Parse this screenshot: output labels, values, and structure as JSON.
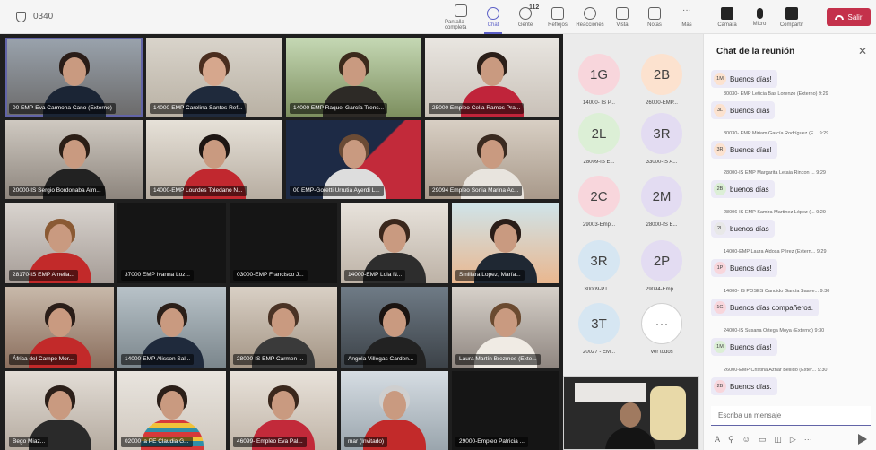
{
  "topbar": {
    "timer": "0340",
    "tools": [
      {
        "label": "Pantalla completa",
        "name": "fullscreen-button"
      },
      {
        "label": "Chat",
        "name": "chat-button",
        "active": true
      },
      {
        "label": "Gente",
        "name": "people-button",
        "count": "112"
      },
      {
        "label": "Reflejos",
        "name": "raise-hand-button"
      },
      {
        "label": "Reacciones",
        "name": "reactions-button"
      },
      {
        "label": "Vista",
        "name": "view-button"
      },
      {
        "label": "Notas",
        "name": "notes-button"
      },
      {
        "label": "Más",
        "name": "more-button"
      }
    ],
    "media": [
      {
        "label": "Cámara",
        "name": "camera-button"
      },
      {
        "label": "Micro",
        "name": "mic-button"
      },
      {
        "label": "Compartir",
        "name": "share-button"
      }
    ],
    "leave_label": "Salir"
  },
  "videos": [
    {
      "name": "00 EMP-Eva Carmona Cano (Externo)"
    },
    {
      "name": "14000-EMP Carolina Santos Ref..."
    },
    {
      "name": "14000 EMP Raquel García Trens..."
    },
    {
      "name": "25000 Empleo Celia Ramos Pra..."
    },
    {
      "name": "20000-IS Sergio Bordonaba Alm..."
    },
    {
      "name": "14000-EMP Lourdes Toledano N..."
    },
    {
      "name": "00 EMP-Goretti Urrutia Ayerdi L..."
    },
    {
      "name": "29094 Empleo Sonia Marina Ac..."
    },
    {
      "name": "28170-IS EMP Amelia..."
    },
    {
      "name": "37000 EMP Ivanna Loz..."
    },
    {
      "name": "03000-EMP Francisco J..."
    },
    {
      "name": "14000-EMP Lola N..."
    },
    {
      "name": "Smillara Lopez, María..."
    },
    {
      "name": "África del Campo Mor..."
    },
    {
      "name": "14000-EMP Alisson Sal..."
    },
    {
      "name": "28000-IS EMP Carmen ..."
    },
    {
      "name": "Angela Villegas Carden..."
    },
    {
      "name": "Laura Martín Brezmes (Exte..."
    },
    {
      "name": "Bego Miaz..."
    },
    {
      "name": "02000 la PE Claudia G..."
    },
    {
      "name": "46099- Empleo Eva Pal..."
    },
    {
      "name": "mar (Invitado)"
    },
    {
      "name": "29000-Empleo Patricia ..."
    }
  ],
  "avatars": [
    {
      "initials": "1G",
      "label": "14000- IS P...",
      "color": "#f8d6dc"
    },
    {
      "initials": "2B",
      "label": "26000-EMP...",
      "color": "#fce2cf"
    },
    {
      "initials": "2L",
      "label": "28009-IS E...",
      "color": "#dcefd6"
    },
    {
      "initials": "3R",
      "label": "33000-IS A...",
      "color": "#e3dcf2"
    },
    {
      "initials": "2C",
      "label": "29003-Emp...",
      "color": "#f8d6dc"
    },
    {
      "initials": "2M",
      "label": "28000-IS E...",
      "color": "#e3dcf2"
    },
    {
      "initials": "3R",
      "label": "30009-PT ...",
      "color": "#d6e6f2"
    },
    {
      "initials": "2P",
      "label": "29094-Emp...",
      "color": "#e3dcf2"
    },
    {
      "initials": "3T",
      "label": "20027 - EM...",
      "color": "#d6e6f2"
    },
    {
      "initials": "···",
      "label": "Ver todos",
      "color": "#ffffff"
    }
  ],
  "chat": {
    "title": "Chat de la reunión",
    "messages": [
      {
        "meta": "",
        "initials": "1M",
        "text": "Buenos días!",
        "color": "#fce2cf"
      },
      {
        "meta": "30030- EMP Leticia Bas Lorenzo (Externo) 9:29",
        "initials": "3L",
        "text": "Buenos días",
        "color": "#fce2cf"
      },
      {
        "meta": "30030- EMP Miriam García Rodríguez (E... 9:29",
        "initials": "3R",
        "text": "Buenos días!",
        "color": "#fce2cf"
      },
      {
        "meta": "28000-IS EMP Margarita Letaia Rincon ... 9:29",
        "initials": "2B",
        "text": "buenos días",
        "color": "#dcefd6"
      },
      {
        "meta": "28006-IS EMP Samira Martinez López (... 9:29",
        "initials": "2L",
        "text": "buenos días",
        "color": "#e8e8e8"
      },
      {
        "meta": "14000-EMP Laura Aldosa Pérez (Extern... 9:29",
        "initials": "1P",
        "text": "Buenos días!",
        "color": "#f8d6dc"
      },
      {
        "meta": "14000- IS POSES Candido García Saave... 9:30",
        "initials": "1G",
        "text": "Buenos días compañeros.",
        "color": "#f8d6dc"
      },
      {
        "meta": "24000-IS Susana Ortega Moya (Externo) 9:30",
        "initials": "1M",
        "text": "Buenos días!",
        "color": "#dcefd6"
      },
      {
        "meta": "26000-EMP Cristina Aznar Bellido (Exter... 9:30",
        "initials": "2B",
        "text": "Buenos días.",
        "color": "#f8d6dc"
      }
    ],
    "compose_placeholder": "Escriba un mensaje"
  }
}
